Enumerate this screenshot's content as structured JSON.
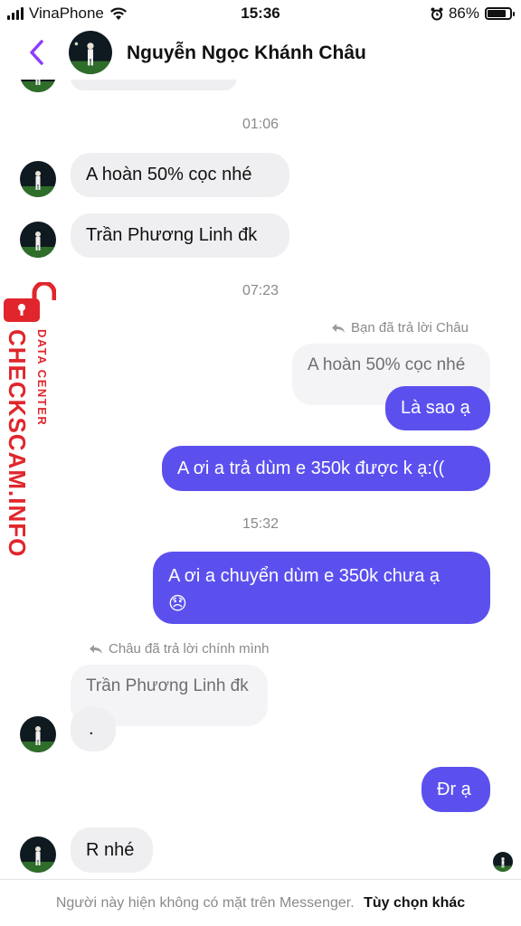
{
  "status_bar": {
    "carrier": "VinaPhone",
    "time": "15:36",
    "battery_percent": "86%",
    "battery_level": 0.86,
    "icons": [
      "signal-bars-icon",
      "wifi-icon",
      "alarm-icon",
      "battery-icon"
    ]
  },
  "header": {
    "contact_name": "Nguyễn Ngọc Khánh Châu",
    "back_icon": "chevron-left-icon",
    "accent_color": "#8b3dff"
  },
  "messages": {
    "ts1": "01:06",
    "m1": "A hoàn 50% cọc nhé",
    "m2": "Trần Phương Linh đk",
    "ts2": "07:23",
    "reply_note_1": "Bạn đã trả lời Châu",
    "quoted_1": "A hoàn 50% cọc nhé",
    "m3": "Là sao ạ",
    "m4": "A ơi a trả dùm e 350k được k ạ:((",
    "ts3": "15:32",
    "m5_line1": "A ơi a chuyển dùm e 350k chưa ạ",
    "m5_emoji": "😞",
    "reply_note_2": "Châu đã trả lời chính mình",
    "quoted_2": "Trần Phương Linh đk",
    "m6": ".",
    "m7": "Đr ạ",
    "m8": "R nhé"
  },
  "footer": {
    "status_text": "Người này hiện không có mặt trên Messenger.",
    "options_link": "Tùy chọn khác"
  },
  "watermark": {
    "main": "CHECKSCAM.INFO",
    "sub": "DATA CENTER",
    "color": "#e0262c"
  },
  "colors": {
    "outgoing_bubble": "#5b50ee",
    "incoming_bubble": "#efeff1"
  }
}
